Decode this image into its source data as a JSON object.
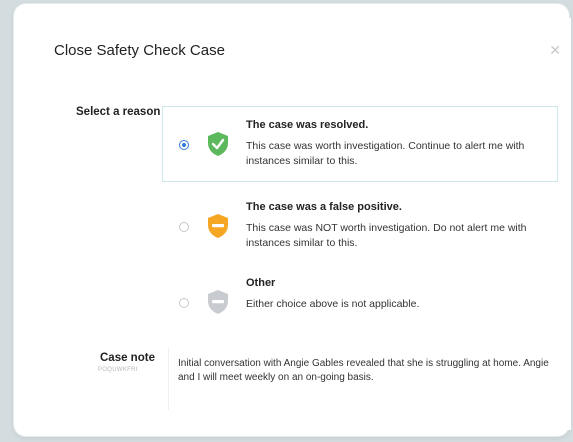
{
  "dialog": {
    "title": "Close Safety Check Case",
    "close_icon": "close-icon"
  },
  "reason": {
    "label": "Select a reason",
    "options": [
      {
        "title": "The case was resolved.",
        "description": "This case was worth investigation. Continue to alert me with instances similar to this.",
        "icon": "check-shield-icon",
        "color": "#5cb85c",
        "selected": true
      },
      {
        "title": "The case was a false positive.",
        "description": "This case was NOT worth investigation. Do not alert me with instances similar to this.",
        "icon": "minus-shield-icon",
        "color": "#f5a623",
        "selected": false
      },
      {
        "title": "Other",
        "description": "Either choice above is not applicable.",
        "icon": "minus-shield-icon",
        "color": "#c8ccd0",
        "selected": false
      }
    ]
  },
  "note": {
    "label": "Case note",
    "sublabel": "POQUWKFRI",
    "text": "Initial conversation with Angie Gables revealed that she is struggling at home. Angie and I will meet weekly on an on-going basis."
  },
  "colors": {
    "radio_selected": "#2f7bd8",
    "selected_border": "#cfe6ec",
    "background": "#d3dcdf"
  }
}
